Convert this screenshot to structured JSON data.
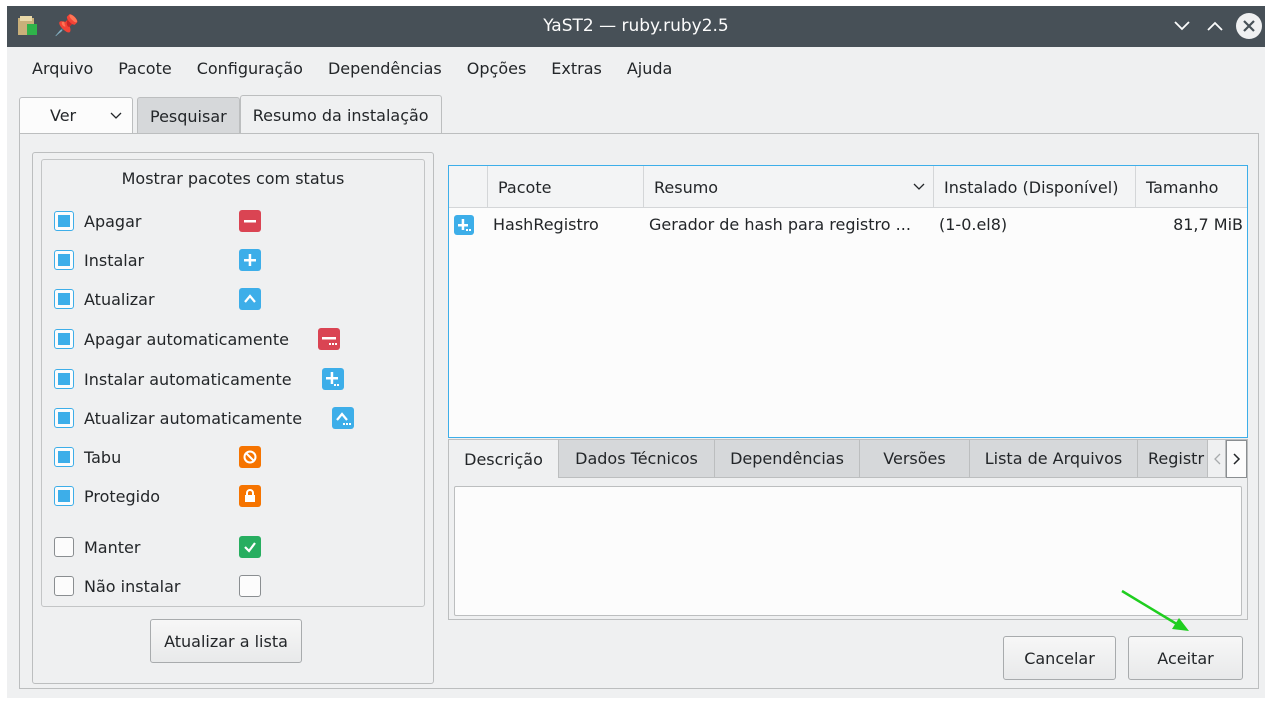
{
  "titlebar": {
    "title": "YaST2 — ruby.ruby2.5",
    "pin_icon": "pin-icon",
    "minimize": "chevron-down-icon",
    "maximize": "chevron-up-icon",
    "close": "close-icon"
  },
  "menu": [
    "Arquivo",
    "Pacote",
    "Configuração",
    "Dependências",
    "Opções",
    "Extras",
    "Ajuda"
  ],
  "tabs": {
    "view_label": "Ver",
    "search_label": "Pesquisar",
    "summary_label": "Resumo da instalação"
  },
  "status_filter": {
    "title": "Mostrar pacotes com status",
    "items": [
      {
        "label": "Apagar",
        "checked": true,
        "icon": "delete-icon"
      },
      {
        "label": "Instalar",
        "checked": true,
        "icon": "install-icon"
      },
      {
        "label": "Atualizar",
        "checked": true,
        "icon": "update-icon"
      },
      {
        "label": "Apagar automaticamente",
        "checked": true,
        "icon": "auto-delete-icon"
      },
      {
        "label": "Instalar automaticamente",
        "checked": true,
        "icon": "auto-install-icon"
      },
      {
        "label": "Atualizar automaticamente",
        "checked": true,
        "icon": "auto-update-icon"
      },
      {
        "label": "Tabu",
        "checked": true,
        "icon": "taboo-icon"
      },
      {
        "label": "Protegido",
        "checked": true,
        "icon": "protected-icon"
      },
      {
        "label": "Manter",
        "checked": false,
        "icon": "keep-icon"
      },
      {
        "label": "Não instalar",
        "checked": false,
        "icon": "no-install-icon"
      }
    ],
    "refresh_label": "Atualizar a lista"
  },
  "table": {
    "columns": [
      "Pacote",
      "Resumo",
      "Instalado (Disponível)",
      "Tamanho"
    ],
    "rows": [
      {
        "status_icon": "install-icon",
        "package": "HashRegistro",
        "summary": "Gerador de hash para registro ...",
        "installed": "(1-0.el8)",
        "size": "81,7 MiB"
      }
    ]
  },
  "details": {
    "tabs": [
      "Descrição",
      "Dados Técnicos",
      "Dependências",
      "Versões",
      "Lista de Arquivos",
      "Registr"
    ],
    "active": "Descrição"
  },
  "actions": {
    "cancel_label": "Cancelar",
    "accept_label": "Aceitar"
  },
  "colors": {
    "titlebar": "#475057",
    "accent": "#3daee9",
    "delete": "#da4453",
    "taboo": "#f67400",
    "keep": "#27ae60",
    "arrow": "#1fce1f"
  }
}
